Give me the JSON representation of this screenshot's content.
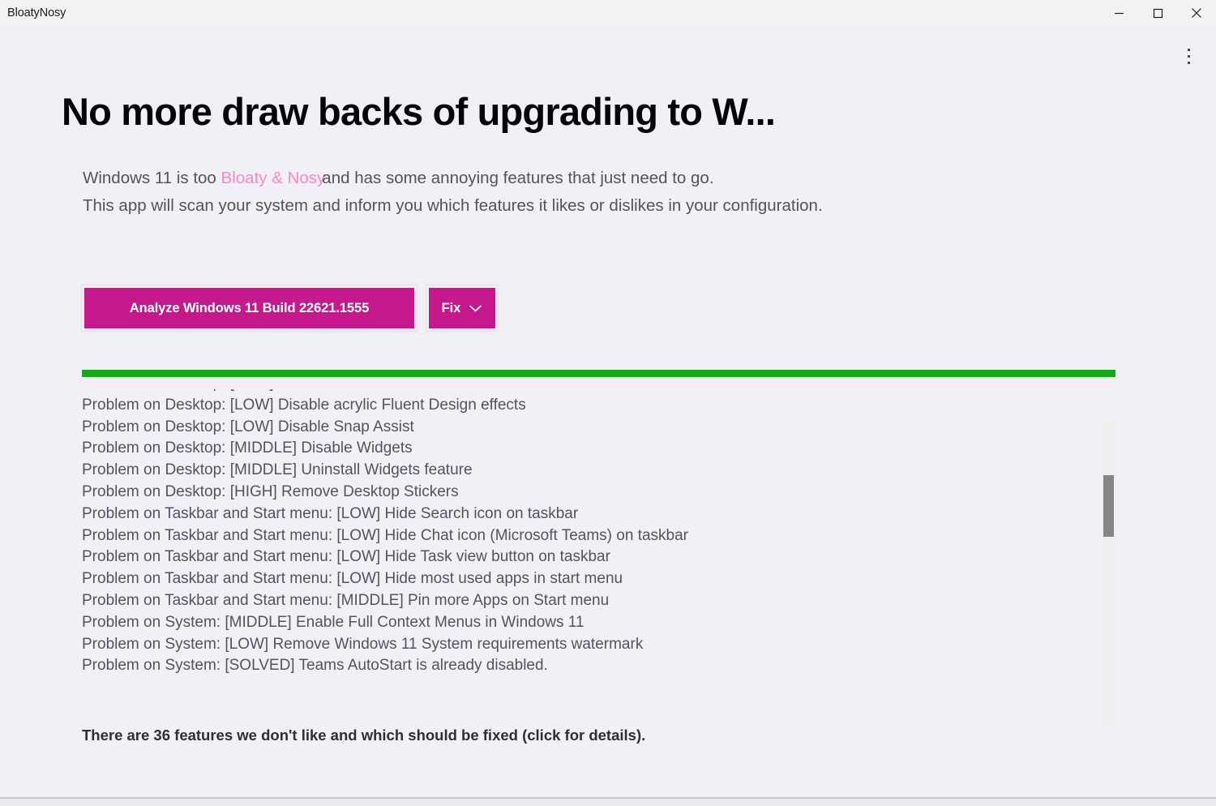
{
  "window": {
    "title": "BloatyNosy",
    "controls": {
      "minimize": "minimize-icon",
      "maximize": "maximize-icon",
      "close": "close-icon"
    },
    "overflow_menu": "more-options-icon"
  },
  "hero": {
    "headline": "No more draw backs of upgrading to W...",
    "subtitle_line1_before": "Windows 11 is too",
    "subtitle_accent": "Bloaty & Nosy",
    "subtitle_line1_after": "and has some annoying features that just need to go.",
    "subtitle_line2": "This app will scan your system and inform you which features it likes or dislikes in your configuration.",
    "accent_color": "#ff86c4"
  },
  "actions": {
    "analyze_label": "Analyze Windows 11 Build 22621.1555",
    "fix_label": "Fix",
    "fix_dropdown_icon": "chevron-down-icon",
    "button_color": "#c4188c"
  },
  "progress": {
    "value": 100,
    "color": "#16a916"
  },
  "results": {
    "items": [
      "Problem on Desktop: [LOW] Use Windows dark theme",
      "Problem on Desktop: [LOW] Disable acrylic Fluent Design effects",
      "Problem on Desktop: [LOW] Disable Snap Assist",
      "Problem on Desktop: [MIDDLE] Disable Widgets",
      "Problem on Desktop: [MIDDLE] Uninstall Widgets feature",
      "Problem on Desktop: [HIGH] Remove Desktop Stickers",
      "Problem on Taskbar and Start menu: [LOW] Hide Search icon on taskbar",
      "Problem on Taskbar and Start menu: [LOW] Hide Chat icon (Microsoft Teams) on taskbar",
      "Problem on Taskbar and Start menu: [LOW] Hide Task view button on taskbar",
      "Problem on Taskbar and Start menu: [LOW] Hide most used apps in start menu",
      "Problem on Taskbar and Start menu: [MIDDLE] Pin more Apps on Start menu",
      "Problem on System: [MIDDLE] Enable Full Context Menus in Windows 11",
      "Problem on System: [LOW] Remove Windows 11 System requirements watermark",
      "Problem on System: [SOLVED] Teams AutoStart is already disabled."
    ],
    "scroll_position_percent": 25
  },
  "footer": {
    "summary": "There are 36 features we don't like and which should be fixed (click for details).",
    "issue_count": 36
  }
}
